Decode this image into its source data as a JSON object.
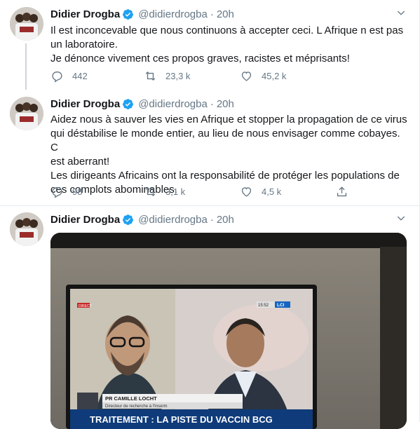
{
  "tweets": [
    {
      "author": "Didier Drogba",
      "handle": "@didierdrogba",
      "separator": "·",
      "time": "20h",
      "lines": [
        "Il est inconcevable que nous continuons à accepter ceci. L Afrique n est pas",
        "un laboratoire.",
        "Je dénonce vivement ces propos graves, racistes et méprisants!"
      ],
      "replies": "442",
      "retweets": "23,3 k",
      "likes": "45,2 k"
    },
    {
      "author": "Didier Drogba",
      "handle": "@didierdrogba",
      "separator": "·",
      "time": "20h",
      "lines": [
        "Aidez nous à sauver les vies en Afrique et stopper la propagation de ce virus",
        "qui déstabilise le monde entier, au lieu de nous envisager comme cobayes. C",
        "est aberrant!",
        "Les dirigeants Africains ont la responsabilité de protéger les populations de",
        "ces complots abominables."
      ],
      "replies": "98",
      "retweets": "3,1 k",
      "likes": "4,5 k"
    },
    {
      "author": "Didier Drogba",
      "handle": "@didierdrogba",
      "separator": "·",
      "time": "20h",
      "media": {
        "badge_direct": "DIRECT",
        "clock": "15:52",
        "channel": "LCI",
        "caption_name": "PR CAMILLE LOCHT",
        "caption_role": "Directeur de recherche à l'Inserm",
        "banner": "TRAITEMENT : LA PISTE DU VACCIN BCG"
      }
    }
  ],
  "colors": {
    "accent": "#1da1f2",
    "muted": "#657786",
    "text": "#14171a",
    "divider": "#e6ecf0"
  }
}
